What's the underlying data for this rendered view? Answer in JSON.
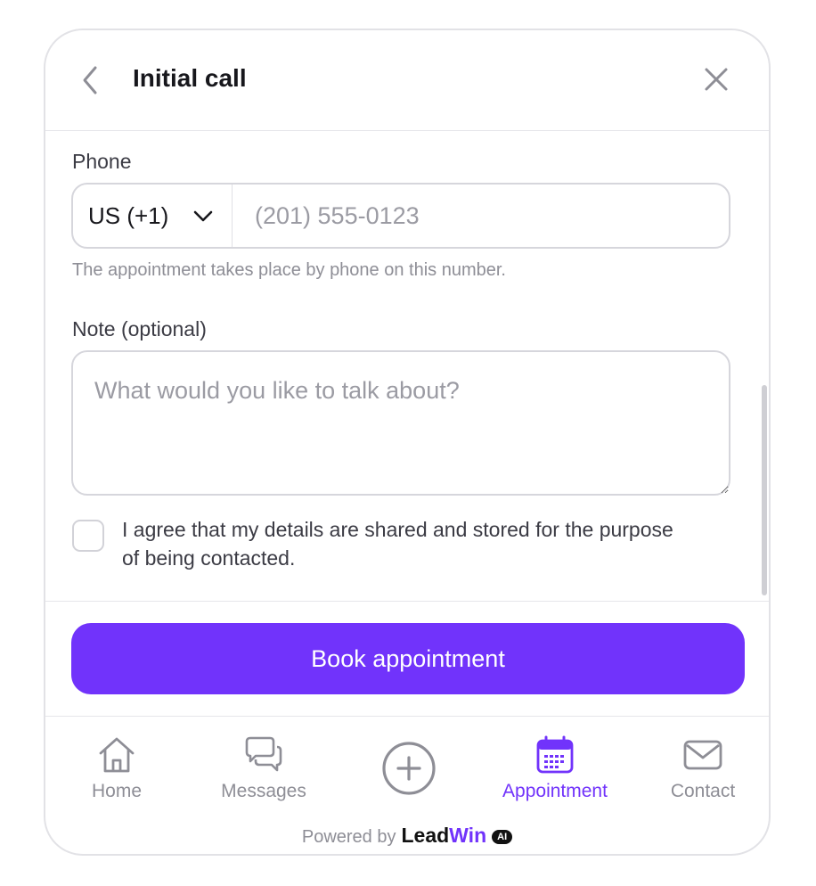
{
  "header": {
    "title": "Initial call",
    "back_icon": "chevron-left-icon",
    "close_icon": "close-icon"
  },
  "phone": {
    "label": "Phone",
    "country_value": "US (+1)",
    "placeholder": "(201) 555-0123",
    "value": "",
    "hint": "The appointment takes place by phone on this number."
  },
  "note": {
    "label": "Note (optional)",
    "placeholder": "What would you like to talk about?",
    "value": ""
  },
  "consent": {
    "checked": false,
    "text": "I agree that my details are shared and stored for the purpose of being contacted."
  },
  "book_button": {
    "label": "Book appointment"
  },
  "nav": {
    "items": [
      {
        "label": "Home",
        "icon": "home-icon"
      },
      {
        "label": "Messages",
        "icon": "messages-icon"
      },
      {
        "label": "",
        "icon": "plus-circle-icon"
      },
      {
        "label": "Appointment",
        "icon": "calendar-icon",
        "active": true
      },
      {
        "label": "Contact",
        "icon": "mail-icon"
      }
    ]
  },
  "footer": {
    "powered_by": "Powered by",
    "brand_lead": "Lead",
    "brand_win": "Win",
    "brand_badge": "AI"
  },
  "colors": {
    "accent": "#7133fb",
    "muted": "#8e8e96",
    "border": "#d6d6dc"
  }
}
